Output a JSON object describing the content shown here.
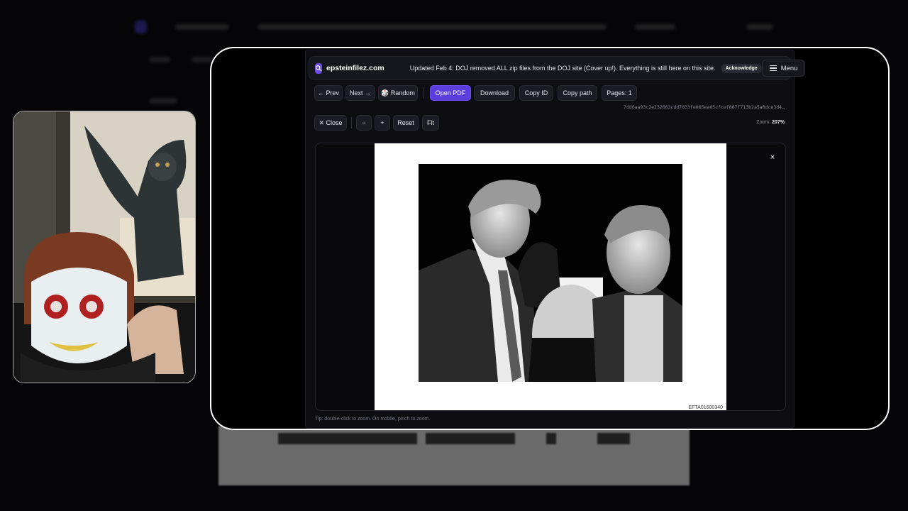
{
  "site": {
    "name": "epsteinfilez.com",
    "notice": "Updated Feb 4: DOJ removed ALL zip files from the DOJ site (Cover up!). Everything is still here on this site.",
    "acknowledge_label": "Acknowledge",
    "menu_label": "Menu"
  },
  "toolbar": {
    "prev_label": "← Prev",
    "next_label": "Next →",
    "random_label": "🎲 Random",
    "open_pdf_label": "Open PDF",
    "download_label": "Download",
    "copy_id_label": "Copy ID",
    "copy_path_label": "Copy path",
    "pages_label": "Pages: 1"
  },
  "file_hash": "7dd6aa93c2e232663cdd7033fe065ea05cfcef867f713b2a5a0dce3d4…",
  "zoom_controls": {
    "close_label": "✕ Close",
    "zoom_out_label": "−",
    "zoom_in_label": "+",
    "reset_label": "Reset",
    "fit_label": "Fit",
    "zoom_prefix": "Zoom:",
    "zoom_value": "207%"
  },
  "viewer": {
    "document_id": "EFTA01600340",
    "close_glyph": "×"
  },
  "tip": "Tip: double-click to zoom. On mobile, pinch to zoom.",
  "colors": {
    "accent": "#5b3fdc",
    "background": "#0d0d12",
    "frame_border": "#ffffff"
  },
  "icons": {
    "brand": "search-icon",
    "menu": "hamburger-icon"
  }
}
